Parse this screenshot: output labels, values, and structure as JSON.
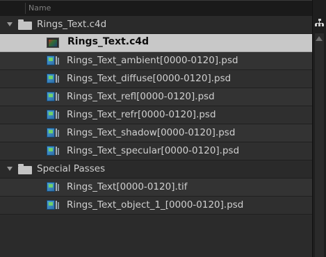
{
  "header": {
    "column_name": "Name"
  },
  "tree": {
    "groups": [
      {
        "label": "Rings_Text.c4d",
        "children": [
          {
            "label": "Rings_Text.c4d",
            "icon": "c4d-file-icon",
            "selected": true
          },
          {
            "label": "Rings_Text_ambient[0000-0120].psd",
            "icon": "psd-sequence-icon"
          },
          {
            "label": "Rings_Text_diffuse[0000-0120].psd",
            "icon": "psd-sequence-icon"
          },
          {
            "label": "Rings_Text_refl[0000-0120].psd",
            "icon": "psd-sequence-icon"
          },
          {
            "label": "Rings_Text_refr[0000-0120].psd",
            "icon": "psd-sequence-icon"
          },
          {
            "label": "Rings_Text_shadow[0000-0120].psd",
            "icon": "psd-sequence-icon"
          },
          {
            "label": "Rings_Text_specular[0000-0120].psd",
            "icon": "psd-sequence-icon"
          }
        ]
      },
      {
        "label": "Special Passes",
        "children": [
          {
            "label": "Rings_Text[0000-0120].tif",
            "icon": "image-sequence-icon"
          },
          {
            "label": "Rings_Text_object_1_[0000-0120].psd",
            "icon": "psd-sequence-icon"
          }
        ]
      }
    ]
  },
  "colors": {
    "selection": "#c8c8c8",
    "panel": "#2b2b2b"
  }
}
